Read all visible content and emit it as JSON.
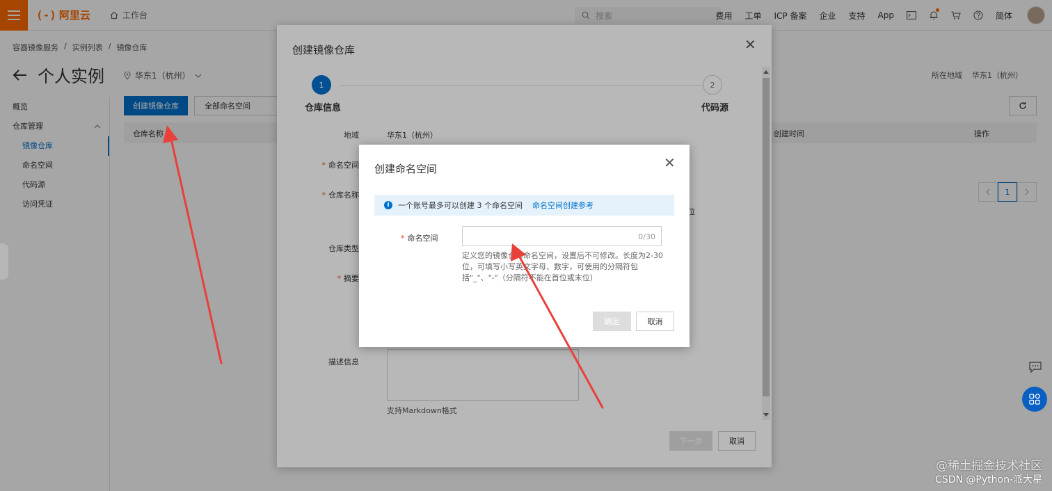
{
  "topbar": {
    "logo_mark": "(-)",
    "logo_text": "阿里云",
    "workbench": "工作台",
    "search_placeholder": "搜索",
    "links": [
      "费用",
      "工单",
      "ICP 备案",
      "企业",
      "支持",
      "App"
    ],
    "lang": "简体"
  },
  "breadcrumb": [
    "容器镜像服务",
    "实例列表",
    "镜像仓库"
  ],
  "breadcrumb_sep": "/",
  "page": {
    "title": "个人实例",
    "region": "华东1（杭州）",
    "region_label_right": "所在地域",
    "region_value_right": "华东1（杭州）"
  },
  "sidebar": {
    "overview": "概览",
    "repo_mgmt": "仓库管理",
    "items": [
      "镜像仓库",
      "命名空间",
      "代码源",
      "访问凭证"
    ]
  },
  "main": {
    "create_btn": "创建镜像仓库",
    "ns_filter": "全部命名空间",
    "col_repo_name": "仓库名称",
    "col_created": "创建时间",
    "col_actions": "操作",
    "page_current": "1"
  },
  "dialog1": {
    "title": "创建镜像仓库",
    "step1_num": "1",
    "step1_label": "仓库信息",
    "step2_num": "2",
    "step2_label": "代码源",
    "region_label": "地域",
    "region_value": "华东1（杭州）",
    "namespace_label": "命名空间",
    "repo_name_label": "仓库名称",
    "repo_type_label": "仓库类型",
    "summary_label": "摘要",
    "desc_label": "描述信息",
    "trailing_text": "位",
    "markdown_hint": "支持Markdown格式",
    "next_btn": "下一步",
    "cancel_btn": "取消"
  },
  "dialog2": {
    "title": "创建命名空间",
    "info_text": "一个账号最多可以创建 3 个命名空间",
    "info_link": "命名空间创建参考",
    "ns_label": "命名空间",
    "ns_value": "",
    "ns_count": "0/30",
    "help_text": "定义您的镜像仓库命名空间，设置后不可修改。长度为2-30位，可填写小写英文字母、数字，可使用的分隔符包括\"_\"、\"-\"（分隔符不能在首位或末位）",
    "ok_btn": "确定",
    "cancel_btn": "取消"
  },
  "watermark": {
    "line1": "@稀土掘金技术社区",
    "line2": "CSDN @Python-派大星"
  },
  "colors": {
    "brand": "#ff6a00",
    "primary": "#0070cc",
    "arrow": "#e8403a"
  }
}
